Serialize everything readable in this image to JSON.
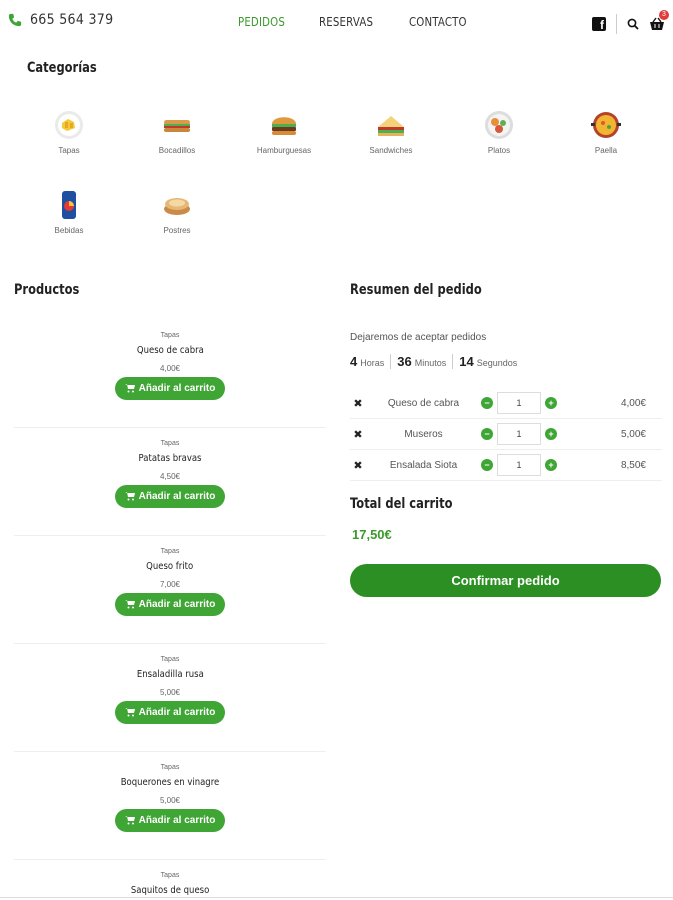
{
  "header": {
    "phone": "665 564 379",
    "nav": [
      "PEDIDOS",
      "RESERVAS",
      "CONTACTO"
    ],
    "active_nav": "PEDIDOS",
    "cart_count": "3",
    "accent_color": "#3a9a2a"
  },
  "categories": {
    "title": "Categorías",
    "items": [
      {
        "label": "Tapas",
        "icon": "tapas-icon"
      },
      {
        "label": "Bocadillos",
        "icon": "sandwich-baguette-icon"
      },
      {
        "label": "Hamburguesas",
        "icon": "burger-icon"
      },
      {
        "label": "Sandwiches",
        "icon": "sandwich-icon"
      },
      {
        "label": "Platos",
        "icon": "plate-icon"
      },
      {
        "label": "Paella",
        "icon": "paella-icon"
      },
      {
        "label": "Bebidas",
        "icon": "drink-can-icon"
      },
      {
        "label": "Postres",
        "icon": "dessert-icon"
      }
    ]
  },
  "products": {
    "title": "Productos",
    "add_label": "Añadir al carrito",
    "items": [
      {
        "category": "Tapas",
        "name": "Queso de cabra",
        "price": "4,00€"
      },
      {
        "category": "Tapas",
        "name": "Patatas bravas",
        "price": "4,50€"
      },
      {
        "category": "Tapas",
        "name": "Queso frito",
        "price": "7,00€"
      },
      {
        "category": "Tapas",
        "name": "Ensaladilla rusa",
        "price": "5,00€"
      },
      {
        "category": "Tapas",
        "name": "Boquerones en vinagre",
        "price": "5,00€"
      },
      {
        "category": "Tapas",
        "name": "Saquitos de queso",
        "price": ""
      }
    ]
  },
  "summary": {
    "title": "Resumen del pedido",
    "deadline_text": "Dejaremos de aceptar pedidos",
    "countdown": [
      {
        "value": "4",
        "unit": "Horas"
      },
      {
        "value": "36",
        "unit": "Minutos"
      },
      {
        "value": "14",
        "unit": "Segundos"
      }
    ],
    "cart": [
      {
        "name": "Queso de cabra",
        "qty": "1",
        "price": "4,00€"
      },
      {
        "name": "Museros",
        "qty": "1",
        "price": "5,00€"
      },
      {
        "name": "Ensalada Siota",
        "qty": "1",
        "price": "8,50€"
      }
    ],
    "total_title": "Total del carrito",
    "total_value": "17,50€",
    "confirm_label": "Confirmar pedido"
  }
}
